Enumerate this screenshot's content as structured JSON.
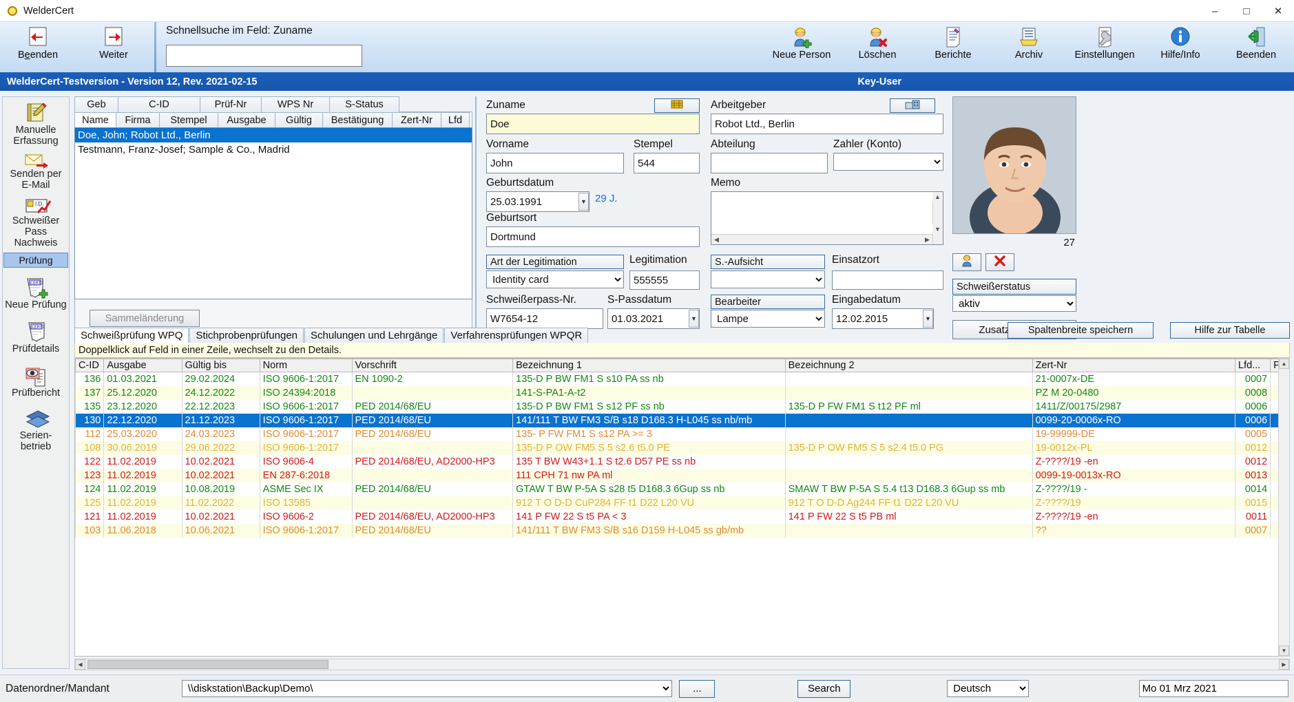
{
  "window": {
    "title": "WelderCert",
    "minimize": "–",
    "maximize": "□",
    "close": "✕"
  },
  "toolbar": {
    "back": {
      "label_pre": "B",
      "label_underlined": "e",
      "label_post": "enden",
      "full": "Beenden"
    },
    "forward": "Weiter",
    "quicksearch_label": "Schnellsuche im Feld: Zuname",
    "quicksearch_value": "",
    "quicksearch_placeholder": "",
    "items": [
      {
        "label": "Neue Person",
        "icon": "person-add-icon"
      },
      {
        "label": "Löschen",
        "icon": "person-delete-icon"
      },
      {
        "label": "Berichte",
        "icon": "report-icon"
      },
      {
        "label": "Archiv",
        "icon": "archive-icon"
      },
      {
        "label": "Einstellungen",
        "icon": "settings-icon"
      },
      {
        "label": "Hilfe/Info",
        "icon": "info-icon"
      },
      {
        "label": "Beenden",
        "icon": "exit-icon"
      }
    ]
  },
  "versionbar": {
    "text": "WelderCert-Testversion - Version 12, Rev. 2021-02-15",
    "user": "Key-User"
  },
  "rail": {
    "items": [
      {
        "label": "Manuelle\nErfassung",
        "line1": "Manuelle",
        "line2": "Erfassung",
        "icon": "edit-note-icon"
      },
      {
        "label": "Senden per\nE-Mail",
        "line1": "Senden per",
        "line2": "E-Mail",
        "icon": "mail-send-icon"
      },
      {
        "label": "Schweißer\nPass\nNachweis",
        "line1": "Schweißer",
        "line2": "Pass",
        "line3": "Nachweis",
        "icon": "id-card-icon"
      }
    ],
    "section_header": "Prüfung",
    "items2": [
      {
        "line1": "Neue Prüfung",
        "icon": "certificate-add-icon"
      },
      {
        "line1": "Prüfdetails",
        "icon": "certificate-icon"
      },
      {
        "line1": "Prüfbericht",
        "icon": "preview-doc-icon"
      },
      {
        "line1": "Serien- betrieb",
        "icon": "batch-icon"
      }
    ]
  },
  "list_panel": {
    "tabs_row1": [
      "Geb",
      "C-ID",
      "Prüf-Nr",
      "WPS Nr",
      "S-Status"
    ],
    "tabs_row2": [
      "Name",
      "Firma",
      "Stempel",
      "Ausgabe",
      "Gültig",
      "Bestätigung",
      "Zert-Nr",
      "Lfd"
    ],
    "selected_tab": "Name",
    "items": [
      {
        "text": "Doe, John; Robot Ltd., Berlin",
        "selected": true
      },
      {
        "text": "Testmann, Franz-Josef; Sample & Co., Madrid",
        "selected": false
      }
    ],
    "bulk_button": "Sammeländerung"
  },
  "form": {
    "zuname_label": "Zuname",
    "zuname_value": "Doe",
    "zuname_button_icon": "id-chip-icon",
    "arbeitgeber_label": "Arbeitgeber",
    "arbeitgeber_value": "Robot Ltd., Berlin",
    "arbeitgeber_button_icon": "company-icon",
    "vorname_label": "Vorname",
    "vorname_value": "John",
    "stempel_label": "Stempel",
    "stempel_value": "544",
    "abteilung_label": "Abteilung",
    "abteilung_value": "",
    "zahler_label": "Zahler (Konto)",
    "zahler_value": "",
    "geburtsdatum_label": "Geburtsdatum",
    "geburtsdatum_value": "25.03.1991",
    "age": "29 J.",
    "memo_label": "Memo",
    "memo_value": "",
    "geburtsort_label": "Geburtsort",
    "geburtsort_value": "Dortmund",
    "art_legitimation_label": "Art der Legitimation",
    "art_legitimation_value": "Identity card",
    "legitimation_label": "Legitimation",
    "legitimation_value": "555555",
    "saufsicht_label": "S.-Aufsicht",
    "saufsicht_value": "",
    "einsatzort_label": "Einsatzort",
    "einsatzort_value": "",
    "schweisserpass_label": "Schweißerpass-Nr.",
    "schweisserpass_value": "W7654-12",
    "spassdatum_label": "S-Passdatum",
    "spassdatum_value": "01.03.2021",
    "bearbeiter_label": "Bearbeiter",
    "bearbeiter_value": "Lampe",
    "eingabedatum_label": "Eingabedatum",
    "eingabedatum_value": "12.02.2015"
  },
  "photo": {
    "count": "27",
    "status_label": "Schweißerstatus",
    "status_value": "aktiv",
    "extra_button": "Zusatzangaben",
    "btn1_icon": "person-icon",
    "btn2_icon": "person-delete-icon"
  },
  "lower": {
    "tabs": [
      "Schweißprüfung WPQ",
      "Stichprobenprüfungen",
      "Schulungen und Lehrgänge",
      "Verfahrensprüfungen WPQR"
    ],
    "selected_tab": "Schweißprüfung WPQ",
    "save_widths_button": "Spaltenbreite speichern",
    "table_help_button": "Hilfe zur Tabelle",
    "hint": "Doppelklick auf Feld in einer Zeile, wechselt zu den Details.",
    "columns": [
      "C-ID",
      "Ausgabe",
      "Gültig bis",
      "Norm",
      "Vorschrift",
      "Bezeichnung 1",
      "Bezeichnung 2",
      "Zert-Nr",
      "Lfd...",
      "F"
    ],
    "rows": [
      {
        "cid": "136",
        "ausgabe": "01.03.2021",
        "gueltig": "29.02.2024",
        "norm": "ISO 9606-1:2017",
        "vorschrift": "EN 1090-2",
        "bez1": "135-D P BW FM1 S s10 PA ss nb",
        "bez2": "",
        "zert": "21-0007x-DE",
        "lfd": "0007",
        "f": "",
        "color": "#118811",
        "sel": false
      },
      {
        "cid": "137",
        "ausgabe": "25.12.2020",
        "gueltig": "24.12.2022",
        "norm": "ISO 24394:2018",
        "vorschrift": "",
        "bez1": "141-S-PA1-A-t2",
        "bez2": "",
        "zert": "PZ M 20-0480",
        "lfd": "0008",
        "f": "",
        "color": "#118811",
        "sel": false
      },
      {
        "cid": "135",
        "ausgabe": "23.12.2020",
        "gueltig": "22.12.2023",
        "norm": "ISO 9606-1:2017",
        "vorschrift": "PED 2014/68/EU",
        "bez1": "135-D P BW FM1 S s12 PF ss nb",
        "bez2": "135-D P FW FM1 S t12 PF ml",
        "zert": "1411/Z/00175/2987",
        "lfd": "0006",
        "f": "",
        "color": "#118811",
        "sel": false
      },
      {
        "cid": "130",
        "ausgabe": "22.12.2020",
        "gueltig": "21.12.2023",
        "norm": "ISO 9606-1:2017",
        "vorschrift": "PED 2014/68/EU",
        "bez1": "141/111 T BW FM3 S/B s18 D168.3 H-L045 ss nb/mb",
        "bez2": "",
        "zert": "0099-20-0006x-RO",
        "lfd": "0006",
        "f": "",
        "color": "#ffffff",
        "sel": true
      },
      {
        "cid": "112",
        "ausgabe": "25.03.2020",
        "gueltig": "24.03.2023",
        "norm": "ISO 9606-1:2017",
        "vorschrift": "PED 2014/68/EU",
        "bez1": "135- P FW FM1 S s12 PA  >= 3",
        "bez2": "",
        "zert": "19-99999-DE",
        "lfd": "0005",
        "f": "",
        "color": "#e08a33",
        "sel": false
      },
      {
        "cid": "108",
        "ausgabe": "30.06.2019",
        "gueltig": "29.06.2022",
        "norm": "ISO 9606-1:2017",
        "vorschrift": "",
        "bez1": "135-D P OW FM5 S 5 s2.6 t5.0 PE",
        "bez2": "135-D P OW FM5 S 5 s2.4 t5.0 PG",
        "zert": "19-0012x-PL",
        "lfd": "0012",
        "f": "",
        "color": "#e3b23c",
        "sel": false
      },
      {
        "cid": "122",
        "ausgabe": "11.02.2019",
        "gueltig": "10.02.2021",
        "norm": "ISO 9606-4",
        "vorschrift": "PED 2014/68/EU, AD2000-HP3",
        "bez1": "135 T BW W43+1.1 S t2.6 D57 PE ss nb",
        "bez2": "",
        "zert": "Z-????/19  -en",
        "lfd": "0012",
        "f": "",
        "color": "#d11a1a",
        "sel": false
      },
      {
        "cid": "123",
        "ausgabe": "11.02.2019",
        "gueltig": "10.02.2021",
        "norm": "EN 287-6:2018",
        "vorschrift": "",
        "bez1": "111 CPH 71 nw PA ml",
        "bez2": "",
        "zert": "0099-19-0013x-RO",
        "lfd": "0013",
        "f": "",
        "color": "#d11a1a",
        "sel": false
      },
      {
        "cid": "124",
        "ausgabe": "11.02.2019",
        "gueltig": "10.08.2019",
        "norm": "ASME Sec IX",
        "vorschrift": "PED 2014/68/EU",
        "bez1": "GTAW T BW P-5A S s28 t5 D168.3 6Gup ss nb",
        "bez2": "SMAW T BW P-5A S 5.4 t13 D168.3 6Gup ss mb",
        "zert": "Z-????/19  -",
        "lfd": "0014",
        "f": "",
        "color": "#118811",
        "sel": false
      },
      {
        "cid": "125",
        "ausgabe": "11.02.2019",
        "gueltig": "11.02.2022",
        "norm": "ISO 13585",
        "vorschrift": "",
        "bez1": "912 T O D-D CuP284 FF t1 D22 L20 VU",
        "bez2": "912 T O D-D Ag244 FF t1 D22 L20 VU",
        "zert": "Z-????/19",
        "lfd": "0015",
        "f": "",
        "color": "#e3b23c",
        "sel": false
      },
      {
        "cid": "121",
        "ausgabe": "11.02.2019",
        "gueltig": "10.02.2021",
        "norm": "ISO 9606-2",
        "vorschrift": "PED 2014/68/EU, AD2000-HP3",
        "bez1": "141 P FW 22 S t5 PA < 3",
        "bez2": "141 P FW 22 S t5 PB ml",
        "zert": "Z-????/19  -en",
        "lfd": "0011",
        "f": "",
        "color": "#d11a1a",
        "sel": false
      },
      {
        "cid": "103",
        "ausgabe": "11.06.2018",
        "gueltig": "10.06.2021",
        "norm": "ISO 9606-1:2017",
        "vorschrift": "PED 2014/68/EU",
        "bez1": "141/111 T BW FM3 S/B s16 D159 H-L045 ss gb/mb",
        "bez2": "",
        "zert": "??",
        "lfd": "0007",
        "f": "",
        "color": "#e08a33",
        "sel": false
      }
    ]
  },
  "statusbar": {
    "folder_label": "Datenordner/Mandant",
    "folder_value": "\\\\diskstation\\Backup\\Demo\\",
    "browse_button": "...",
    "search_button": "Search",
    "language_value": "Deutsch",
    "date_value": "Mo 01 Mrz 2021"
  },
  "colors": {
    "accent": "#1b5fba",
    "selection": "#0a72cf",
    "alt_row": "#fdfde4",
    "yellow_field": "#fbfbd7"
  }
}
